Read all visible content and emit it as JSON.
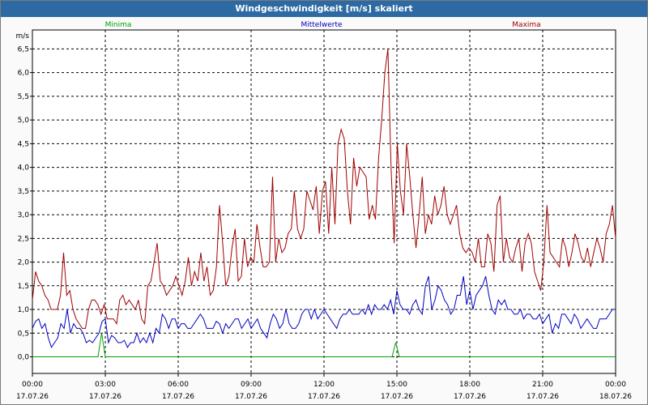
{
  "title": "Windgeschwindigkeit [m/s] skaliert",
  "chart_data": {
    "type": "line",
    "unit": "m/s",
    "ylim": [
      -0.35,
      6.9
    ],
    "yticks": [
      "0,0",
      "0,5",
      "1,0",
      "1,5",
      "2,0",
      "2,5",
      "3,0",
      "3,5",
      "4,0",
      "4,5",
      "5,0",
      "5,5",
      "6,0",
      "6,5"
    ],
    "xlim_hours": [
      0,
      24
    ],
    "xticks": [
      {
        "time": "00:00",
        "date": "17.07.26"
      },
      {
        "time": "03:00",
        "date": "17.07.26"
      },
      {
        "time": "06:00",
        "date": "17.07.26"
      },
      {
        "time": "09:00",
        "date": "17.07.26"
      },
      {
        "time": "12:00",
        "date": "17.07.26"
      },
      {
        "time": "15:00",
        "date": "17.07.26"
      },
      {
        "time": "18:00",
        "date": "17.07.26"
      },
      {
        "time": "21:00",
        "date": "17.07.26"
      },
      {
        "time": "00:00",
        "date": "18.07.26"
      }
    ],
    "grid": true,
    "series": [
      {
        "name": "Minima",
        "color": "#00a000",
        "points": [
          [
            0,
            0
          ],
          [
            2.7,
            0
          ],
          [
            2.85,
            0.5
          ],
          [
            3.0,
            0
          ],
          [
            14.8,
            0
          ],
          [
            14.95,
            0.3
          ],
          [
            15.1,
            0
          ],
          [
            24,
            0
          ]
        ]
      },
      {
        "name": "Mittelwerte",
        "color": "#0000c0",
        "values": [
          0.6,
          0.75,
          0.8,
          0.6,
          0.7,
          0.4,
          0.2,
          0.3,
          0.4,
          0.7,
          0.6,
          1.0,
          0.5,
          0.7,
          0.6,
          0.6,
          0.5,
          0.3,
          0.35,
          0.3,
          0.4,
          0.5,
          0.75,
          0.8,
          0.3,
          0.45,
          0.4,
          0.3,
          0.3,
          0.35,
          0.2,
          0.3,
          0.3,
          0.5,
          0.3,
          0.4,
          0.3,
          0.5,
          0.3,
          0.6,
          0.5,
          0.9,
          0.8,
          0.6,
          0.8,
          0.8,
          0.6,
          0.7,
          0.7,
          0.6,
          0.6,
          0.7,
          0.8,
          0.9,
          0.8,
          0.6,
          0.6,
          0.6,
          0.75,
          0.7,
          0.5,
          0.7,
          0.6,
          0.7,
          0.8,
          0.8,
          0.6,
          0.7,
          0.8,
          0.6,
          0.7,
          0.8,
          0.6,
          0.5,
          0.4,
          0.7,
          0.9,
          0.8,
          0.6,
          0.7,
          1.0,
          0.7,
          0.6,
          0.6,
          0.7,
          0.9,
          1.0,
          1.0,
          0.8,
          1.0,
          0.8,
          0.9,
          1.0,
          0.9,
          0.8,
          0.7,
          0.6,
          0.8,
          0.9,
          0.9,
          1.0,
          0.9,
          0.9,
          0.9,
          1.0,
          0.9,
          1.1,
          0.9,
          1.1,
          1.0,
          1.0,
          1.1,
          1.0,
          1.2,
          0.9,
          1.4,
          1.1,
          1.0,
          1.0,
          0.9,
          1.1,
          1.2,
          1.0,
          0.9,
          1.5,
          1.7,
          1.0,
          1.2,
          1.5,
          1.4,
          1.2,
          1.1,
          0.9,
          1.0,
          1.3,
          1.3,
          1.7,
          1.1,
          1.4,
          1.0,
          1.3,
          1.4,
          1.5,
          1.7,
          1.3,
          1.0,
          0.9,
          1.2,
          1.1,
          1.2,
          1.0,
          1.0,
          0.9,
          0.9,
          1.0,
          0.8,
          0.9,
          0.9,
          0.8,
          0.8,
          0.9,
          0.7,
          0.8,
          0.9,
          0.5,
          0.7,
          0.6,
          0.9,
          0.9,
          0.8,
          0.7,
          0.9,
          0.8,
          0.6,
          0.7,
          0.8,
          0.7,
          0.6,
          0.6,
          0.8,
          0.8,
          0.8,
          0.9,
          1.0,
          1.0
        ]
      },
      {
        "name": "Maxima",
        "color": "#a00000",
        "values": [
          1.2,
          1.8,
          1.6,
          1.5,
          1.3,
          1.2,
          1.0,
          1.0,
          1.0,
          1.3,
          2.2,
          1.3,
          1.4,
          1.0,
          0.8,
          0.7,
          0.6,
          0.6,
          1.0,
          1.2,
          1.2,
          1.1,
          0.9,
          1.1,
          0.8,
          0.8,
          0.8,
          0.7,
          1.2,
          1.3,
          1.1,
          1.2,
          1.1,
          1.0,
          1.2,
          0.8,
          0.7,
          1.5,
          1.6,
          2.0,
          2.4,
          1.6,
          1.5,
          1.3,
          1.4,
          1.5,
          1.7,
          1.5,
          1.3,
          1.6,
          2.1,
          1.5,
          1.8,
          1.6,
          2.2,
          1.6,
          1.9,
          1.3,
          1.4,
          1.9,
          3.2,
          2.4,
          1.5,
          1.7,
          2.3,
          2.7,
          1.6,
          1.7,
          2.5,
          1.9,
          2.1,
          2.0,
          2.8,
          2.3,
          1.9,
          1.9,
          2.0,
          3.8,
          2.0,
          2.5,
          2.2,
          2.3,
          2.6,
          2.7,
          3.5,
          2.7,
          2.5,
          2.7,
          3.5,
          3.3,
          3.1,
          3.6,
          2.6,
          3.5,
          3.7,
          2.6,
          4.0,
          2.8,
          4.5,
          4.8,
          4.6,
          3.5,
          2.8,
          4.2,
          3.6,
          4.0,
          3.9,
          3.8,
          2.9,
          3.2,
          2.9,
          4.2,
          5.0,
          6.0,
          6.5,
          4.0,
          2.4,
          4.5,
          3.5,
          3.0,
          4.5,
          3.8,
          3.0,
          2.3,
          3.0,
          3.8,
          2.6,
          3.0,
          2.8,
          3.4,
          3.0,
          3.2,
          3.6,
          3.0,
          2.8,
          3.0,
          3.2,
          2.6,
          2.3,
          2.2,
          2.3,
          2.2,
          2.0,
          2.5,
          1.9,
          1.9,
          2.6,
          2.4,
          1.8,
          3.2,
          3.4,
          2.0,
          2.5,
          2.1,
          2.0,
          2.3,
          2.5,
          1.8,
          2.4,
          2.6,
          2.4,
          1.8,
          1.6,
          1.4,
          2.0,
          3.2,
          2.2,
          2.1,
          2.0,
          1.9,
          2.5,
          2.3,
          1.9,
          2.2,
          2.6,
          2.4,
          2.1,
          2.0,
          2.3,
          1.9,
          2.2,
          2.5,
          2.3,
          2.0,
          2.6,
          2.8,
          3.2,
          2.5
        ]
      }
    ]
  }
}
